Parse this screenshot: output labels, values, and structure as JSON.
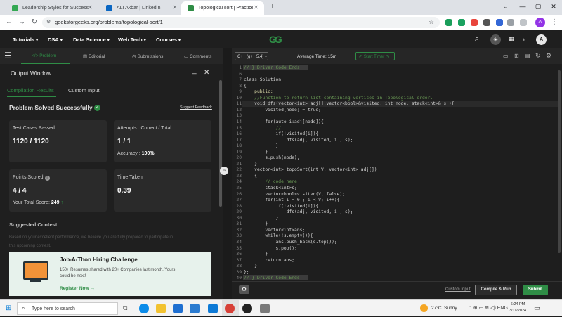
{
  "browser": {
    "tabs": [
      {
        "title": "Leadership Styles for Success",
        "favicon_color": "#34a853"
      },
      {
        "title": "ALI Akbar | LinkedIn",
        "favicon_color": "#0a66c2"
      },
      {
        "title": "Topological sort | Practice | Gee",
        "favicon_color": "#2f8d46"
      }
    ],
    "new_tab": "+",
    "window": {
      "minimize": "⌄",
      "min": "—",
      "max": "▢",
      "close": "✕"
    },
    "url": "geeksforgeeks.org/problems/topological-sort/1",
    "profile_initial": "A"
  },
  "gfg_nav": {
    "menus": [
      "Tutorials",
      "DSA",
      "Data Science",
      "Web Tech",
      "Courses"
    ],
    "logo": "GG"
  },
  "left_tabs": {
    "problem": "</> Problem",
    "editorial": "Editorial",
    "submissions": "Submissions",
    "comments": "Comments"
  },
  "output": {
    "title": "Output Window",
    "tabs": [
      "Compilation Results",
      "Custom Input"
    ],
    "status": "Problem Solved Successfully",
    "suggest": "Suggest Feedback",
    "test_cases_label": "Test Cases Passed",
    "test_cases_value": "1120 / 1120",
    "attempts_label": "Attempts : Correct / Total",
    "attempts_value": "1 / 1",
    "accuracy_label": "Accuracy :",
    "accuracy_value": "100%",
    "points_label": "Points Scored",
    "points_value": "4 / 4",
    "total_score_label": "Your Total Score:",
    "total_score_value": "249",
    "time_label": "Time Taken",
    "time_value": "0.39",
    "suggested_contest": "Suggested Contest",
    "contest_text_1": "Based on your excellent performance, we believe you are fully prepared to participate in",
    "contest_text_2": "this upcoming contest.",
    "banner_title": "Job-A-Thon Hiring Challenge",
    "banner_desc_1": "150+ Resumes shared with 20+ Companies last month. Yours",
    "banner_desc_2": "could be next!",
    "banner_cta": "Register Now"
  },
  "editor": {
    "language": "C++ (g++ 5.4)",
    "avg_time_label": "Average Time: 15m",
    "timer_label": "Start Timer",
    "lines": [
      {
        "n": "1",
        "t": "// } Driver Code Ends",
        "c": "#6a9955",
        "hl": true
      },
      {
        "n": "6",
        "t": ""
      },
      {
        "n": "7",
        "t": "class Solution"
      },
      {
        "n": "8",
        "t": "{"
      },
      {
        "n": "9",
        "t": "    public:",
        "c": "#dcdcaa"
      },
      {
        "n": "10",
        "t": "    //Function to return list containing vertices in Topological order.",
        "c": "#6a9955"
      },
      {
        "n": "11",
        "t": "    void dfs(vector<int> adj[],vector<bool>&visited, int node, stack<int>& s ){",
        "cur": true
      },
      {
        "n": "12",
        "t": "        visited[node] = true;"
      },
      {
        "n": "13",
        "t": ""
      },
      {
        "n": "14",
        "t": "        for(auto i:adj[node]){"
      },
      {
        "n": "15",
        "t": "            //",
        "c": "#6a9955"
      },
      {
        "n": "16",
        "t": "            if(!visited[i]){"
      },
      {
        "n": "17",
        "t": "                dfs(adj, visited, i , s);"
      },
      {
        "n": "18",
        "t": "            }"
      },
      {
        "n": "19",
        "t": "        }"
      },
      {
        "n": "20",
        "t": "        s.push(node);"
      },
      {
        "n": "21",
        "t": "    }"
      },
      {
        "n": "22",
        "t": "    vector<int> topoSort(int V, vector<int> adj[])"
      },
      {
        "n": "23",
        "t": "    {"
      },
      {
        "n": "24",
        "t": "        // code here",
        "c": "#6a9955"
      },
      {
        "n": "25",
        "t": "        stack<int>s;"
      },
      {
        "n": "26",
        "t": "        vector<bool>visited(V, false);"
      },
      {
        "n": "27",
        "t": "        for(int i = 0 ; i < V; i++){"
      },
      {
        "n": "28",
        "t": "            if(!visited[i]){"
      },
      {
        "n": "29",
        "t": "                dfs(adj, visited, i , s);"
      },
      {
        "n": "30",
        "t": "            }"
      },
      {
        "n": "31",
        "t": "        }"
      },
      {
        "n": "32",
        "t": "        vector<int>ans;"
      },
      {
        "n": "33",
        "t": "        while(!s.empty()){"
      },
      {
        "n": "34",
        "t": "            ans.push_back(s.top());"
      },
      {
        "n": "35",
        "t": "            s.pop();"
      },
      {
        "n": "36",
        "t": "        }"
      },
      {
        "n": "37",
        "t": "        return ans;"
      },
      {
        "n": "38",
        "t": "    }"
      },
      {
        "n": "39",
        "t": "};"
      },
      {
        "n": "40",
        "t": "// } Driver Code Ends",
        "c": "#6a9955",
        "hl": true
      }
    ],
    "custom_input": "Custom Input",
    "compile_run": "Compile & Run",
    "submit": "Submit"
  },
  "taskbar": {
    "search_placeholder": "Type here to search",
    "weather": "27°C  Sunny",
    "time": "6:24 PM",
    "date": "3/11/2024"
  },
  "colors": {
    "accent": "#2f8d46",
    "nav_bg": "#1f1f1f"
  }
}
